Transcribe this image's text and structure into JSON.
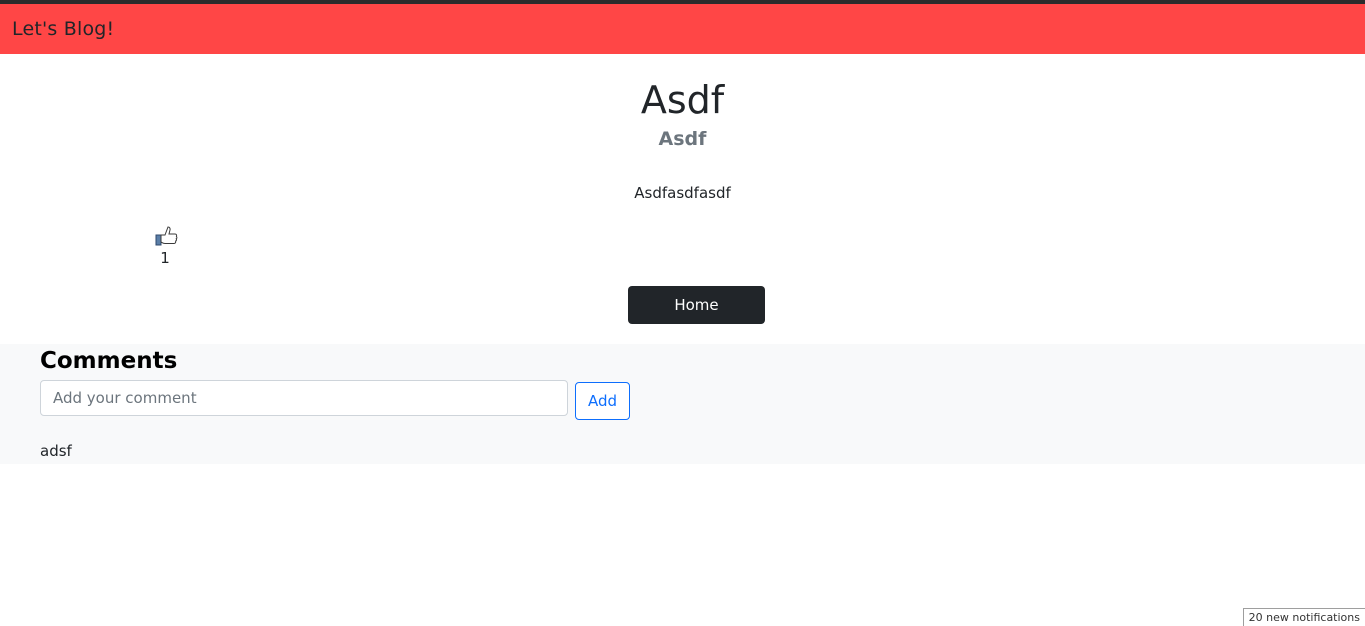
{
  "navbar": {
    "brand": "Let's Blog!"
  },
  "post": {
    "title": "Asdf",
    "subtitle": "Asdf",
    "body": "Asdfasdfasdf",
    "likes": "1",
    "like_icon": "thumbs-up-icon"
  },
  "actions": {
    "home_label": "Home"
  },
  "comments": {
    "heading": "Comments",
    "input_placeholder": "Add your comment",
    "add_label": "Add",
    "items": [
      "adsf"
    ]
  },
  "status": {
    "notifications": "20 new notifications"
  },
  "colors": {
    "navbar": "#ff4646",
    "home_button": "#212529",
    "add_button": "#0d6efd",
    "comments_bg": "#f8f9fa"
  }
}
